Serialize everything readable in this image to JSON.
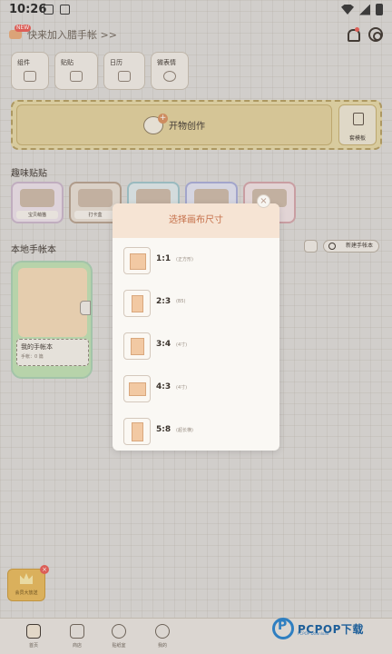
{
  "status_bar": {
    "time": "10:26"
  },
  "header": {
    "promo_text": "快来加入腊手帐 >>",
    "promo_badge": "NEW"
  },
  "quick_actions": [
    {
      "label": "组件",
      "icon": "widget-icon"
    },
    {
      "label": "贴贴",
      "icon": "sticker-bow-icon"
    },
    {
      "label": "日历",
      "icon": "calendar-icon"
    },
    {
      "label": "微表情",
      "icon": "smiley-icon"
    }
  ],
  "create": {
    "label": "开物创作",
    "template_label": "套模板"
  },
  "sections": {
    "stickers_title": "趣味贴贴",
    "local_title": "本地手帐本"
  },
  "stickers": [
    "宝贝萌猫",
    "打卡盒",
    "",
    "",
    ""
  ],
  "local": {
    "add_button": "新建手帐本"
  },
  "notebook": {
    "title": "我的手帐本",
    "count": "手帐：0 篇"
  },
  "badge": {
    "label": "会员大放送"
  },
  "modal": {
    "title": "选择画布尺寸",
    "close": "×",
    "options": [
      {
        "ratio": "1:1",
        "desc": "(正方形)"
      },
      {
        "ratio": "2:3",
        "desc": "(B5)"
      },
      {
        "ratio": "3:4",
        "desc": "(4寸)"
      },
      {
        "ratio": "4:3",
        "desc": "(4寸)"
      },
      {
        "ratio": "5:8",
        "desc": "(超长横)"
      }
    ]
  },
  "tabs": [
    {
      "label": "首页",
      "icon": "home-icon",
      "active": true
    },
    {
      "label": "商店",
      "icon": "shop-icon"
    },
    {
      "label": "贴纸室",
      "icon": "sticker-room-icon"
    },
    {
      "label": "我的",
      "icon": "profile-icon"
    }
  ],
  "watermark": {
    "text": "PCPOP下载",
    "sub": "PCPOP Download"
  },
  "colors": {
    "accent": "#c5704a",
    "banner": "#e4d6a3",
    "swatch": "#f2c9a3"
  }
}
